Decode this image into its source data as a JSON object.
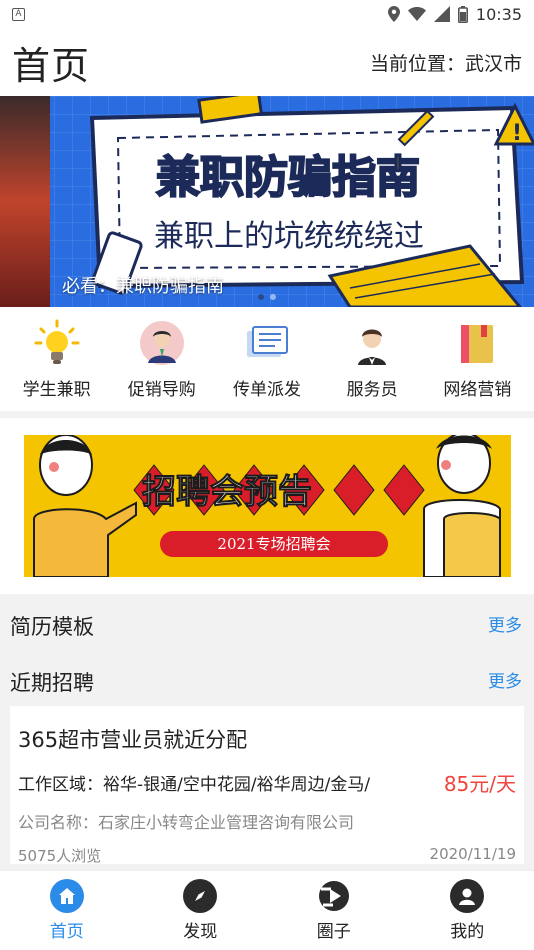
{
  "status_bar": {
    "time": "10:35",
    "app_icon_letter": "A"
  },
  "header": {
    "title": "首页",
    "location": "当前位置：武汉市"
  },
  "banner": {
    "caption": "必看：兼职防骗指南",
    "headline": "兼职防骗指南",
    "subline": "兼职上的坑统统绕过"
  },
  "categories": [
    {
      "label": "学生兼职",
      "icon": "lightbulb-icon"
    },
    {
      "label": "促销导购",
      "icon": "saleswoman-icon"
    },
    {
      "label": "传单派发",
      "icon": "flyer-icon"
    },
    {
      "label": "服务员",
      "icon": "waiter-icon"
    },
    {
      "label": "网络营销",
      "icon": "notebook-icon"
    }
  ],
  "promo": {
    "headline": "招聘会预告",
    "badge": "2021专场招聘会"
  },
  "sections": {
    "resume": {
      "title": "简历模板",
      "more": "更多"
    },
    "recent": {
      "title": "近期招聘",
      "more": "更多"
    }
  },
  "jobs": [
    {
      "title": "365超市营业员就近分配",
      "area": "工作区域：裕华-银通/空中花园/裕华周边/金马/",
      "salary": "85元/天",
      "company": "公司名称：石家庄小转弯企业管理咨询有限公司",
      "views": "5075人浏览",
      "date": "2020/11/19"
    }
  ],
  "tabbar": [
    {
      "label": "首页",
      "icon": "home-icon",
      "active": true
    },
    {
      "label": "发现",
      "icon": "compass-icon",
      "active": false
    },
    {
      "label": "圈子",
      "icon": "circle-icon",
      "active": false
    },
    {
      "label": "我的",
      "icon": "user-icon",
      "active": false
    }
  ],
  "colors": {
    "accent": "#2a8be8",
    "salary": "#f0443c",
    "banner_bg": "#2a6de0",
    "promo_bg": "#f5c400"
  }
}
